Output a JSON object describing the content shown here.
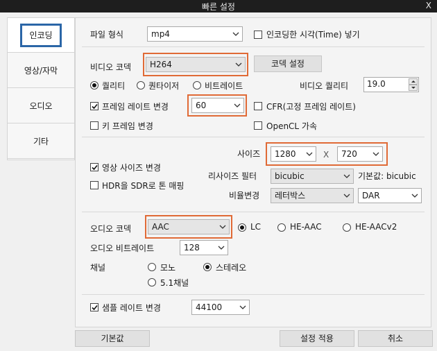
{
  "window": {
    "title": "빠른 설정",
    "close_label": "X"
  },
  "sidebar": {
    "items": [
      {
        "label": "인코딩"
      },
      {
        "label": "영상/자막"
      },
      {
        "label": "오디오"
      },
      {
        "label": "기타"
      }
    ]
  },
  "file": {
    "format_label": "파일 형식",
    "format_value": "mp4",
    "timestamp_label": "인코딩한 시각(Time) 넣기"
  },
  "video": {
    "codec_label": "비디오 코덱",
    "codec_value": "H264",
    "codec_settings_button": "코덱 설정",
    "mode_quality": "퀄리티",
    "mode_quantizer": "퀀타이저",
    "mode_bitrate": "비트레이트",
    "quality_label": "비디오 퀄리티",
    "quality_value": "19.0",
    "framerate_change_label": "프레임 레이트 변경",
    "framerate_value": "60",
    "cfr_label": "CFR(고정 프레임 레이트)",
    "keyframe_label": "키 프레임 변경",
    "opencl_label": "OpenCL 가속"
  },
  "resize": {
    "size_label": "사이즈",
    "width_value": "1280",
    "x_label": "X",
    "height_value": "720",
    "change_size_label": "영상 사이즈 변경",
    "filter_label": "리사이즈 필터",
    "filter_value": "bicubic",
    "filter_default_label": "기본값: bicubic",
    "hdr_label": "HDR을 SDR로 톤 매핑",
    "ratio_label": "비율변경",
    "ratio_value": "레터박스",
    "ratio_mode_value": "DAR"
  },
  "audio": {
    "codec_label": "오디오 코덱",
    "codec_value": "AAC",
    "profile_lc": "LC",
    "profile_he": "HE-AAC",
    "profile_hev2": "HE-AACv2",
    "bitrate_label": "오디오 비트레이트",
    "bitrate_value": "128",
    "channel_label": "채널",
    "channel_mono": "모노",
    "channel_stereo": "스테레오",
    "channel_51": "5.1채널",
    "samplerate_change_label": "샘플 레이트 변경",
    "samplerate_value": "44100"
  },
  "footer": {
    "default_button": "기본값",
    "apply_button": "설정 적용",
    "cancel_button": "취소"
  },
  "colors": {
    "highlight": "#e06a36",
    "active_tab_border": "#2b66a7"
  }
}
